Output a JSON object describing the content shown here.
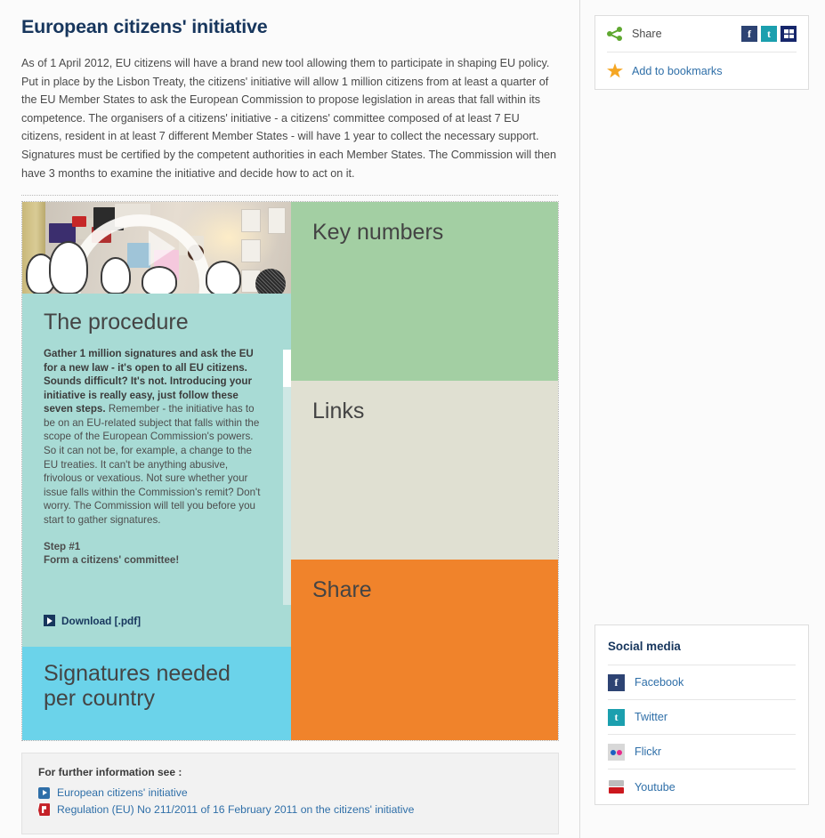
{
  "header": {
    "title": "European citizens' initiative",
    "intro": "As of 1 April 2012, EU citizens will have a brand new tool allowing them to participate in shaping EU policy. Put in place by the Lisbon Treaty, the citizens' initiative will allow 1 million citizens from at least a quarter of the EU Member States to ask the European Commission to propose legislation in areas that fall within its competence. The organisers of a citizens' initiative - a citizens' committee composed of at least 7 EU citizens, resident in at least 7 different Member States - will have 1 year to collect the necessary support. Signatures must be certified by the competent authorities in each Member States. The Commission will then have 3 months to examine the initiative and decide how to act on it."
  },
  "tiles": {
    "procedure": {
      "heading": "The procedure",
      "lead": "Gather 1 million signatures and ask the EU for a new law - it's open to all EU citizens. Sounds difficult? It's not. Introducing your initiative is really easy, just follow these seven steps.",
      "body": "Remember - the initiative has to be on an EU-related subject that falls within the scope of the European Commission's powers. So it can not be, for example, a change to the EU treaties. It can't be anything abusive, frivolous or vexatious. Not sure whether your issue falls within the Commission's remit? Don't worry. The Commission will tell you before you start to gather signatures.",
      "step_label": "Step #1",
      "step_text": "Form a citizens' committee!",
      "download_label": "Download [.pdf]"
    },
    "signatures": {
      "heading": "Signatures needed per country"
    },
    "key_numbers": {
      "heading": "Key numbers"
    },
    "links": {
      "heading": "Links"
    },
    "share": {
      "heading": "Share"
    }
  },
  "further": {
    "title": "For further information see :",
    "links": [
      {
        "label": "European citizens' initiative",
        "icon": "external-link-icon"
      },
      {
        "label": "Regulation (EU) No 211/2011 of 16 February 2011 on the citizens' initiative",
        "icon": "pdf-icon"
      }
    ]
  },
  "sidebar": {
    "share_box": {
      "share_label": "Share",
      "bookmark_label": "Add to bookmarks",
      "buttons": [
        {
          "name": "facebook",
          "glyph": "f"
        },
        {
          "name": "twitter",
          "glyph": "t"
        },
        {
          "name": "msn",
          "glyph": ""
        }
      ]
    },
    "social_media": {
      "title": "Social media",
      "items": [
        {
          "label": "Facebook",
          "glyph": "f"
        },
        {
          "label": "Twitter",
          "glyph": "t"
        },
        {
          "label": "Flickr",
          "glyph": ""
        },
        {
          "label": "Youtube",
          "glyph": ""
        }
      ]
    }
  },
  "colors": {
    "title": "#17365d",
    "procedure_tile": "#a8dbd5",
    "signatures_tile": "#6bd3ea",
    "key_numbers_tile": "#a3cfa3",
    "links_tile": "#e0e0d2",
    "share_tile": "#f0832b",
    "link_blue": "#2f6fa8"
  }
}
